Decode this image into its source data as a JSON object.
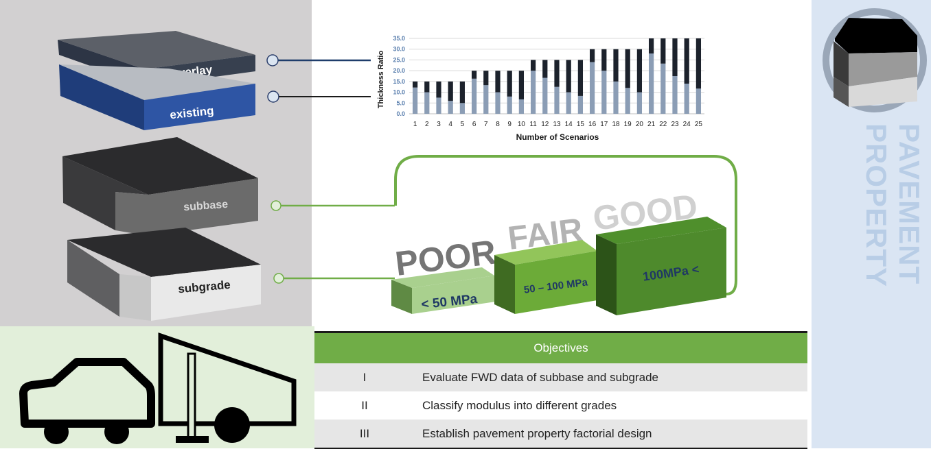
{
  "title": "PAVEMENT PROPERTY",
  "layers": {
    "overlay": "overlay",
    "existing": "existing",
    "subbase": "subbase",
    "subgrade": "subgrade"
  },
  "grades": {
    "poor": "POOR",
    "fair": "FAIR",
    "good": "GOOD",
    "poor_range": "< 50 MPa",
    "fair_range": "50 – 100 MPa",
    "good_range": "100MPa <"
  },
  "objectives": {
    "header": "Objectives",
    "rows": [
      {
        "num": "I",
        "text": "Evaluate FWD data of subbase and subgrade"
      },
      {
        "num": "II",
        "text": "Classify modulus into different grades"
      },
      {
        "num": "III",
        "text": "Establish pavement property factorial design"
      }
    ]
  },
  "chart_data": {
    "type": "bar",
    "stacked": true,
    "xlabel": "Number of Scenarios",
    "ylabel": "Thickness Ratio",
    "ylim": [
      0,
      35
    ],
    "yticks": [
      "0.0",
      "5.0",
      "10.0",
      "15.0",
      "20.0",
      "25.0",
      "30.0",
      "35.0"
    ],
    "grid": true,
    "categories": [
      "1",
      "2",
      "3",
      "4",
      "5",
      "6",
      "7",
      "8",
      "9",
      "10",
      "11",
      "12",
      "13",
      "14",
      "15",
      "16",
      "17",
      "18",
      "19",
      "20",
      "21",
      "22",
      "23",
      "24",
      "25"
    ],
    "series": [
      {
        "values": [
          12.2,
          10.0,
          7.5,
          6.0,
          5.0,
          16.3,
          13.3,
          10.0,
          8.0,
          6.7,
          20.0,
          16.7,
          12.5,
          10.0,
          8.3,
          24.0,
          20.0,
          15.0,
          12.0,
          10.0,
          28.0,
          23.3,
          17.5,
          14.0,
          11.7
        ],
        "color": "#8b9db5"
      },
      {
        "values": [
          2.8,
          5.0,
          7.5,
          9.0,
          10.0,
          3.7,
          6.7,
          10.0,
          12.0,
          13.3,
          5.0,
          8.3,
          12.5,
          15.0,
          16.7,
          6.0,
          10.0,
          15.0,
          18.0,
          20.0,
          7.0,
          11.7,
          17.5,
          21.0,
          23.3
        ],
        "color": "#1c222c"
      }
    ],
    "totals_colors": {
      "axis_text": "#5a7fae"
    }
  }
}
